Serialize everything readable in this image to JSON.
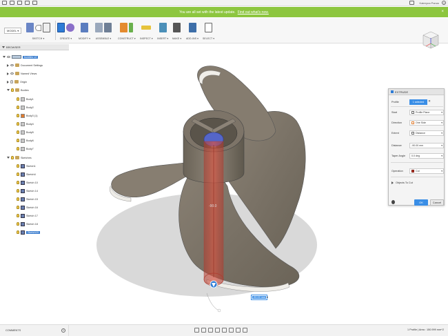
{
  "titlebar": {
    "user_name": "Kateryna Panus",
    "help": "?"
  },
  "banner": {
    "message": "You are all set with the latest update.",
    "link": "Find out what's new.",
    "close": "×"
  },
  "toolbar": {
    "workspace": "MODEL ▾",
    "groups": [
      "SKETCH ▾",
      "CREATE ▾",
      "MODIFY ▾",
      "ASSEMBLE ▾",
      "CONSTRUCT ▾",
      "INSPECT ▾",
      "INSERT ▾",
      "MAKE ▾",
      "ADD-INS ▾",
      "SELECT ▾"
    ]
  },
  "browser": {
    "header": "BROWSER",
    "component": "buddies v2",
    "items": [
      {
        "label": "Document Settings"
      },
      {
        "label": "Named Views"
      },
      {
        "label": "Origin"
      },
      {
        "label": "Bodies"
      },
      {
        "label": "Body1"
      },
      {
        "label": "Body2"
      },
      {
        "label": "Body3 (1)"
      },
      {
        "label": "Body4"
      },
      {
        "label": "Body5"
      },
      {
        "label": "Body6"
      },
      {
        "label": "Body7"
      },
      {
        "label": "Sketches"
      },
      {
        "label": "Sketch1"
      },
      {
        "label": "Sketch4"
      },
      {
        "label": "Sketch 10"
      },
      {
        "label": "Sketch 14"
      },
      {
        "label": "Sketch 15"
      },
      {
        "label": "Sketch 16"
      },
      {
        "label": "Sketch 17"
      },
      {
        "label": "Sketch 18"
      },
      {
        "label": "Sketch19"
      }
    ]
  },
  "extrude": {
    "title": "EXTRUDE",
    "rows": [
      {
        "label": "Profile",
        "value": "1 selected"
      },
      {
        "label": "Start",
        "value": "Profile Plane"
      },
      {
        "label": "Direction",
        "value": "One Side"
      },
      {
        "label": "Extent",
        "value": "Distance"
      },
      {
        "label": "Distance",
        "value": "-90.00 mm"
      },
      {
        "label": "Taper Angle",
        "value": "0.0 deg"
      },
      {
        "label": "Operation",
        "value": "Cut"
      }
    ],
    "objects_to_cut": "Objects To Cut",
    "ok": "OK",
    "cancel": "Cancel"
  },
  "viewport": {
    "distance_input": "-90.00 mm",
    "dimension_label": "-90.0"
  },
  "bottombar": {
    "comments": "COMMENTS",
    "status": "1 Profile | Area : 150.999 mm^2"
  },
  "colors": {
    "banner": "#8dc63f",
    "accent": "#3a8ee6",
    "model": "#7d7468",
    "cut_preview": "#c0392b"
  }
}
